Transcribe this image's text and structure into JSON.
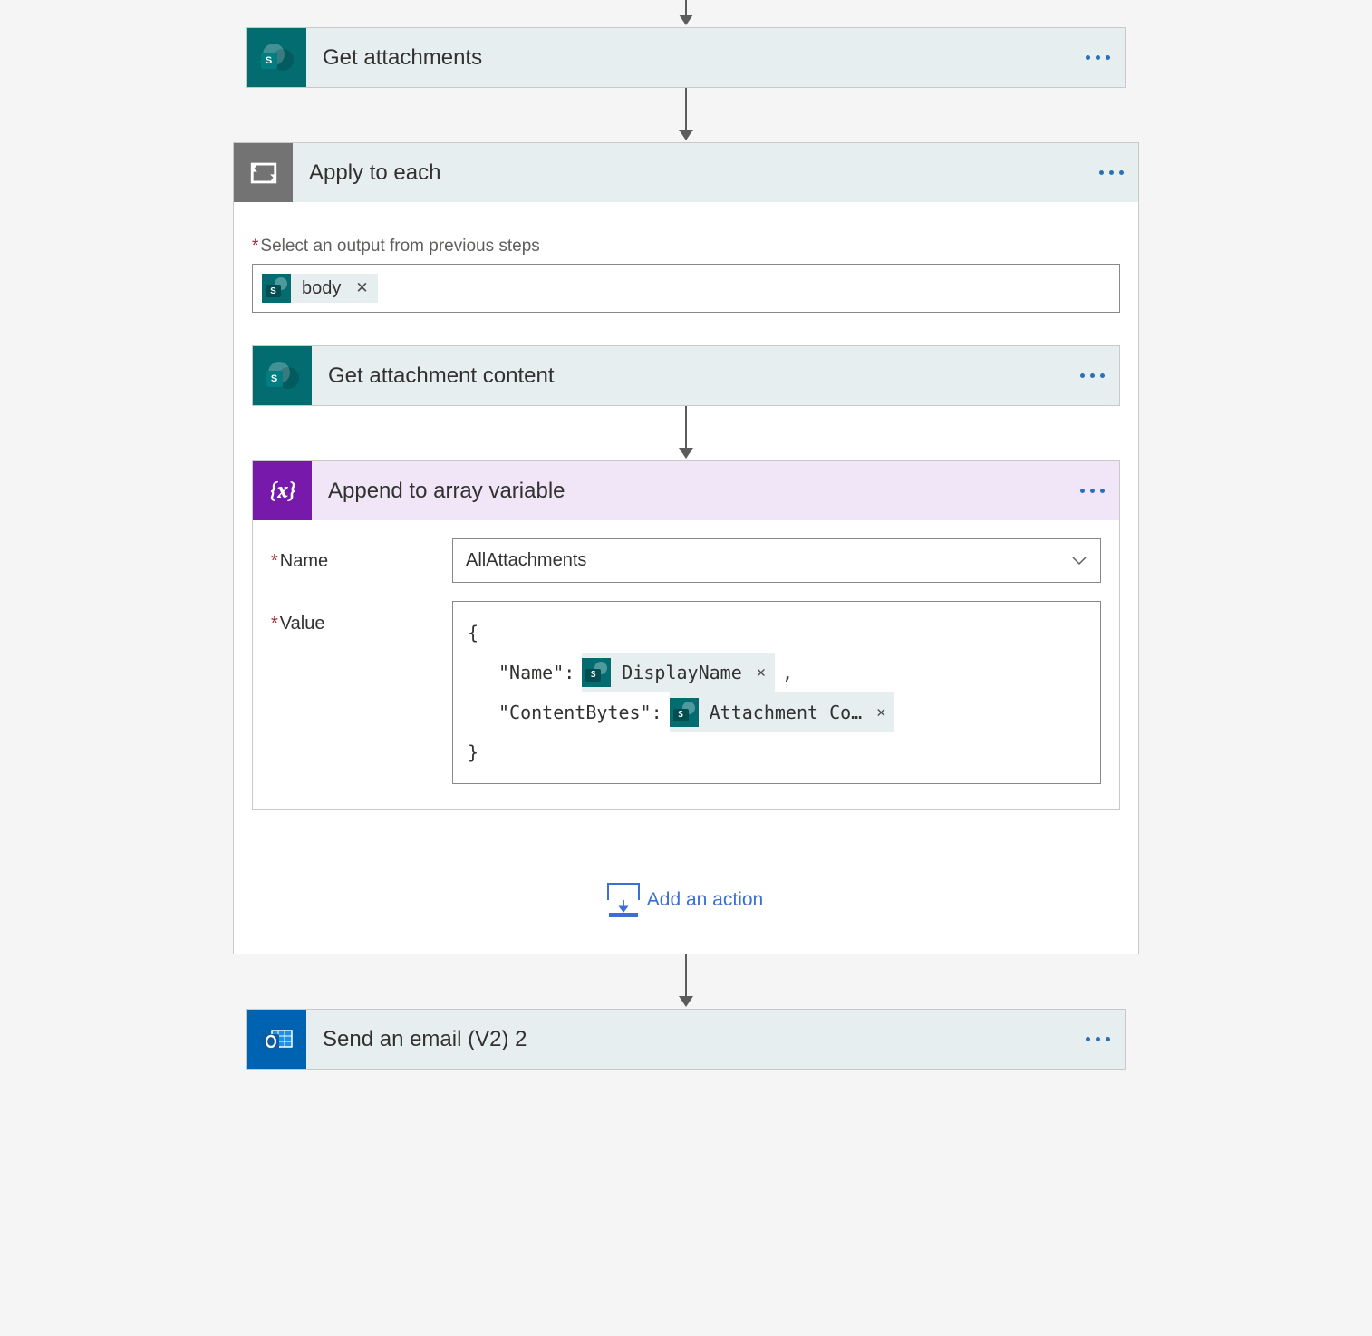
{
  "flow": {
    "step1": {
      "title": "Get attachments"
    },
    "loop": {
      "title": "Apply to each",
      "select_label": "Select an output from previous steps",
      "select_token": "body",
      "step_inner1": {
        "title": "Get attachment content"
      },
      "step_inner2": {
        "title": "Append to array variable",
        "name_label": "Name",
        "name_value": "AllAttachments",
        "value_label": "Value",
        "expr": {
          "open": "{",
          "k1": "\"Name\":",
          "t1": "DisplayName",
          "comma": ",",
          "k2": "\"ContentBytes\":",
          "t2": "Attachment Co…",
          "close": "}"
        }
      },
      "add_action": "Add an action"
    },
    "step_last": {
      "title": "Send an email (V2) 2"
    }
  },
  "glyphs": {
    "close": "✕",
    "chev": "⌄"
  }
}
